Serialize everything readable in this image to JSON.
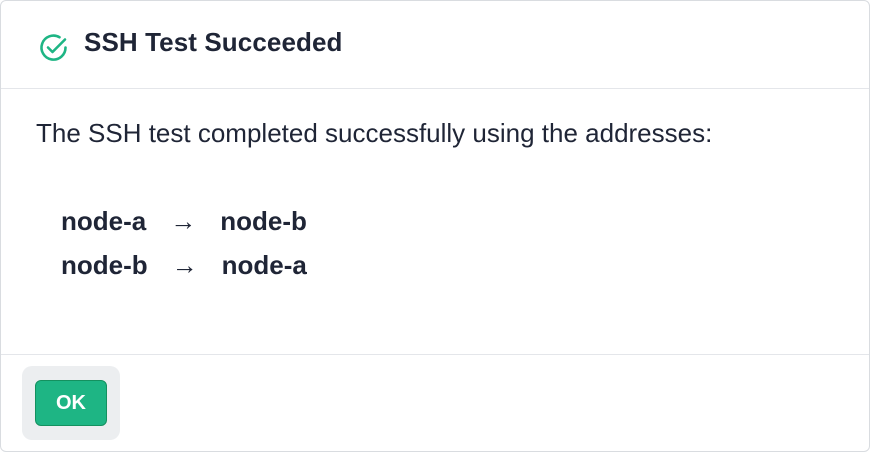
{
  "dialog": {
    "title": "SSH Test Succeeded",
    "icon": "check-circle-icon",
    "accent_color": "#1eb584",
    "message": "The SSH test completed successfully using the addresses:",
    "routes": [
      {
        "from": "node-a",
        "arrow": "→",
        "to": "node-b"
      },
      {
        "from": "node-b",
        "arrow": "→",
        "to": "node-a"
      }
    ],
    "ok_label": "OK"
  }
}
